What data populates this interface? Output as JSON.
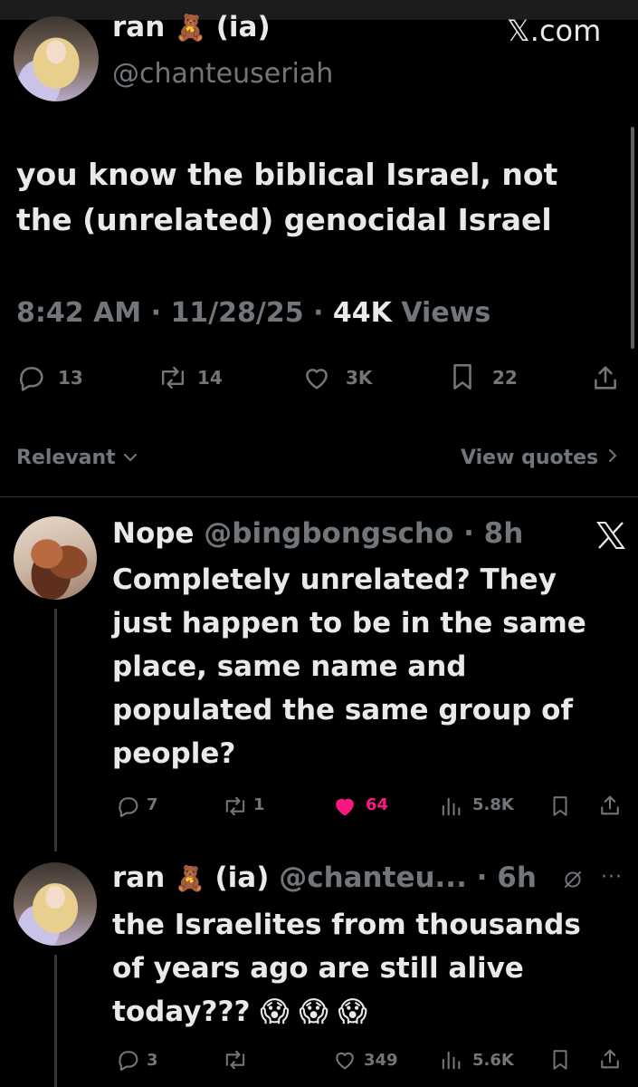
{
  "main_tweet": {
    "display_name": "ran",
    "emoji": "🧸",
    "name_suffix": "(ia)",
    "handle": "@chanteuseriah",
    "site_label": "𝕏.com",
    "text": "you know the biblical Israel, not the (unrelated) genocidal Israel",
    "time": "8:42 AM",
    "date": "11/28/25",
    "views_count": "44K",
    "views_label": "Views",
    "stats": {
      "replies": "13",
      "reposts": "14",
      "likes": "3K",
      "bookmarks": "22"
    }
  },
  "filter_bar": {
    "sort_label": "Relevant",
    "view_quotes_label": "View quotes"
  },
  "reply_1": {
    "display_name": "Nope",
    "handle": "@bingbongscho",
    "time": "8h",
    "text": "Completely unrelated? They just happen to be in the same place, same name and populated the same group of people?",
    "stats": {
      "replies": "7",
      "reposts": "1",
      "likes": "64",
      "views": "5.8K"
    },
    "like_color": "#f91880"
  },
  "reply_2": {
    "display_name": "ran",
    "emoji": "🧸",
    "name_suffix": "(ia)",
    "handle": "@chanteu...",
    "time": "6h",
    "text": "the Israelites from thousands of years ago are still alive today??? 😱 😱 😱",
    "stats": {
      "replies": "3",
      "reposts": "",
      "likes": "349",
      "views": "5.6K"
    }
  }
}
